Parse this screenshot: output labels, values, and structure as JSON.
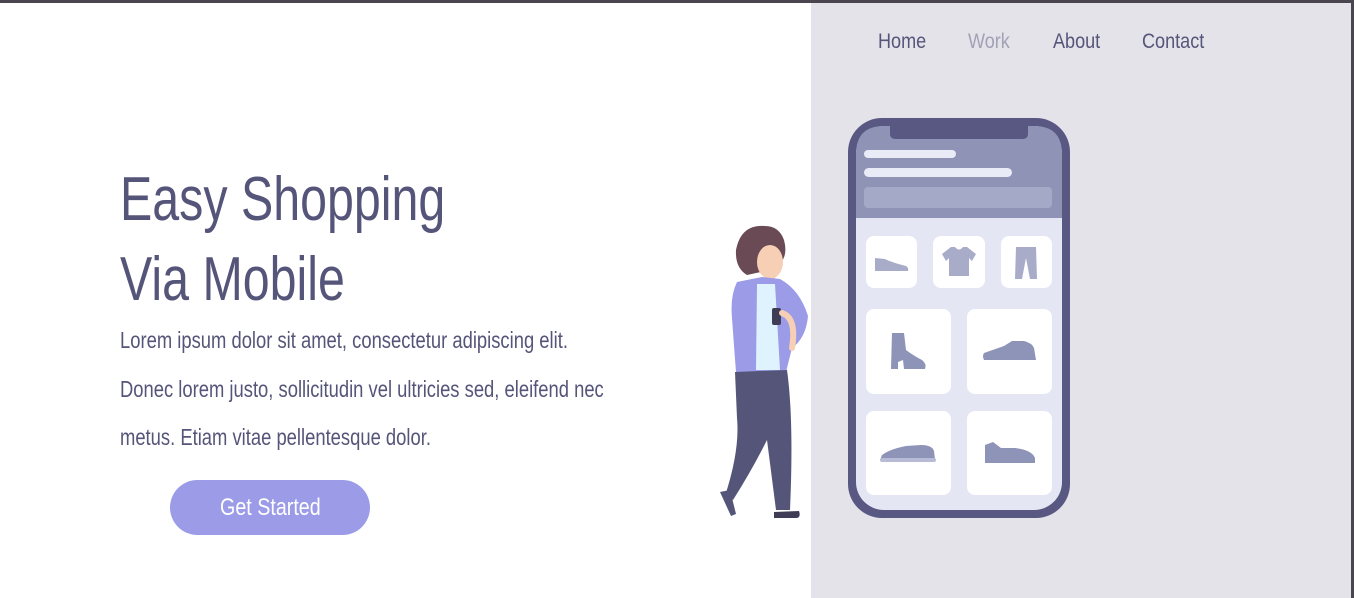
{
  "nav": {
    "items": [
      {
        "label": "Home",
        "active": false
      },
      {
        "label": "Work",
        "active": true
      },
      {
        "label": "About",
        "active": false
      },
      {
        "label": "Contact",
        "active": false
      }
    ]
  },
  "hero": {
    "title_line1": "Easy Shopping",
    "title_line2": "Via Mobile",
    "description": "Lorem ipsum dolor sit amet, consectetur adipiscing elit. Donec lorem justo, sollicitudin vel ultricies sed, eleifend nec metus. Etiam vitae pellentesque dolor.",
    "cta_label": "Get Started"
  },
  "colors": {
    "primary_text": "#55557a",
    "nav_active": "#a3a1b5",
    "accent_button": "#9b9be8",
    "panel_background": "#e4e3ea",
    "phone_frame": "#585883"
  },
  "illustration": {
    "icons": [
      "sneaker-icon",
      "tshirt-icon",
      "pants-icon",
      "boot-icon",
      "running-shoe-icon",
      "low-shoe-icon",
      "sneaker-low-icon"
    ]
  }
}
